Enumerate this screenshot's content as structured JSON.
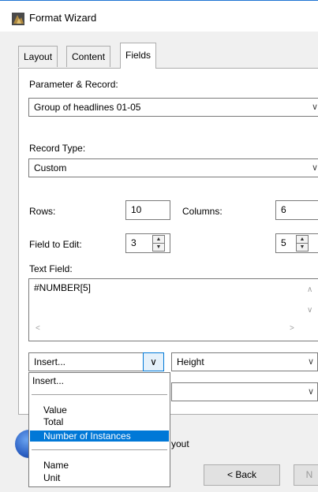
{
  "window": {
    "title": "Format Wizard"
  },
  "tabs": [
    {
      "label": "Layout"
    },
    {
      "label": "Content"
    },
    {
      "label": "Fields"
    }
  ],
  "parameter": {
    "label": "Parameter & Record:",
    "value": "Group of headlines 01-05"
  },
  "record_type": {
    "label": "Record Type:",
    "value": "Custom"
  },
  "rows": {
    "label": "Rows:",
    "value": "10"
  },
  "columns": {
    "label": "Columns:",
    "value": "6"
  },
  "field_to_edit": {
    "label": "Field to Edit:",
    "value_row": "3",
    "value_col": "5"
  },
  "text_field": {
    "label": "Text Field:",
    "value": "#NUMBER[5]"
  },
  "insert_combo": {
    "value": "Insert..."
  },
  "height_combo": {
    "value": "Height"
  },
  "insert_list": {
    "items": [
      "Insert...",
      "Value",
      "Total",
      "Number of Instances",
      "Name",
      "Unit"
    ],
    "selected": "Number of Instances"
  },
  "bottom": {
    "layout_text": "yout",
    "back_label": "< Back",
    "next_label": "N"
  },
  "icons": {
    "chevron": "chevron-down-icon",
    "spin": "spin-arrows-icon",
    "app": "format-wizard-app-icon",
    "globe": "globe-icon"
  }
}
